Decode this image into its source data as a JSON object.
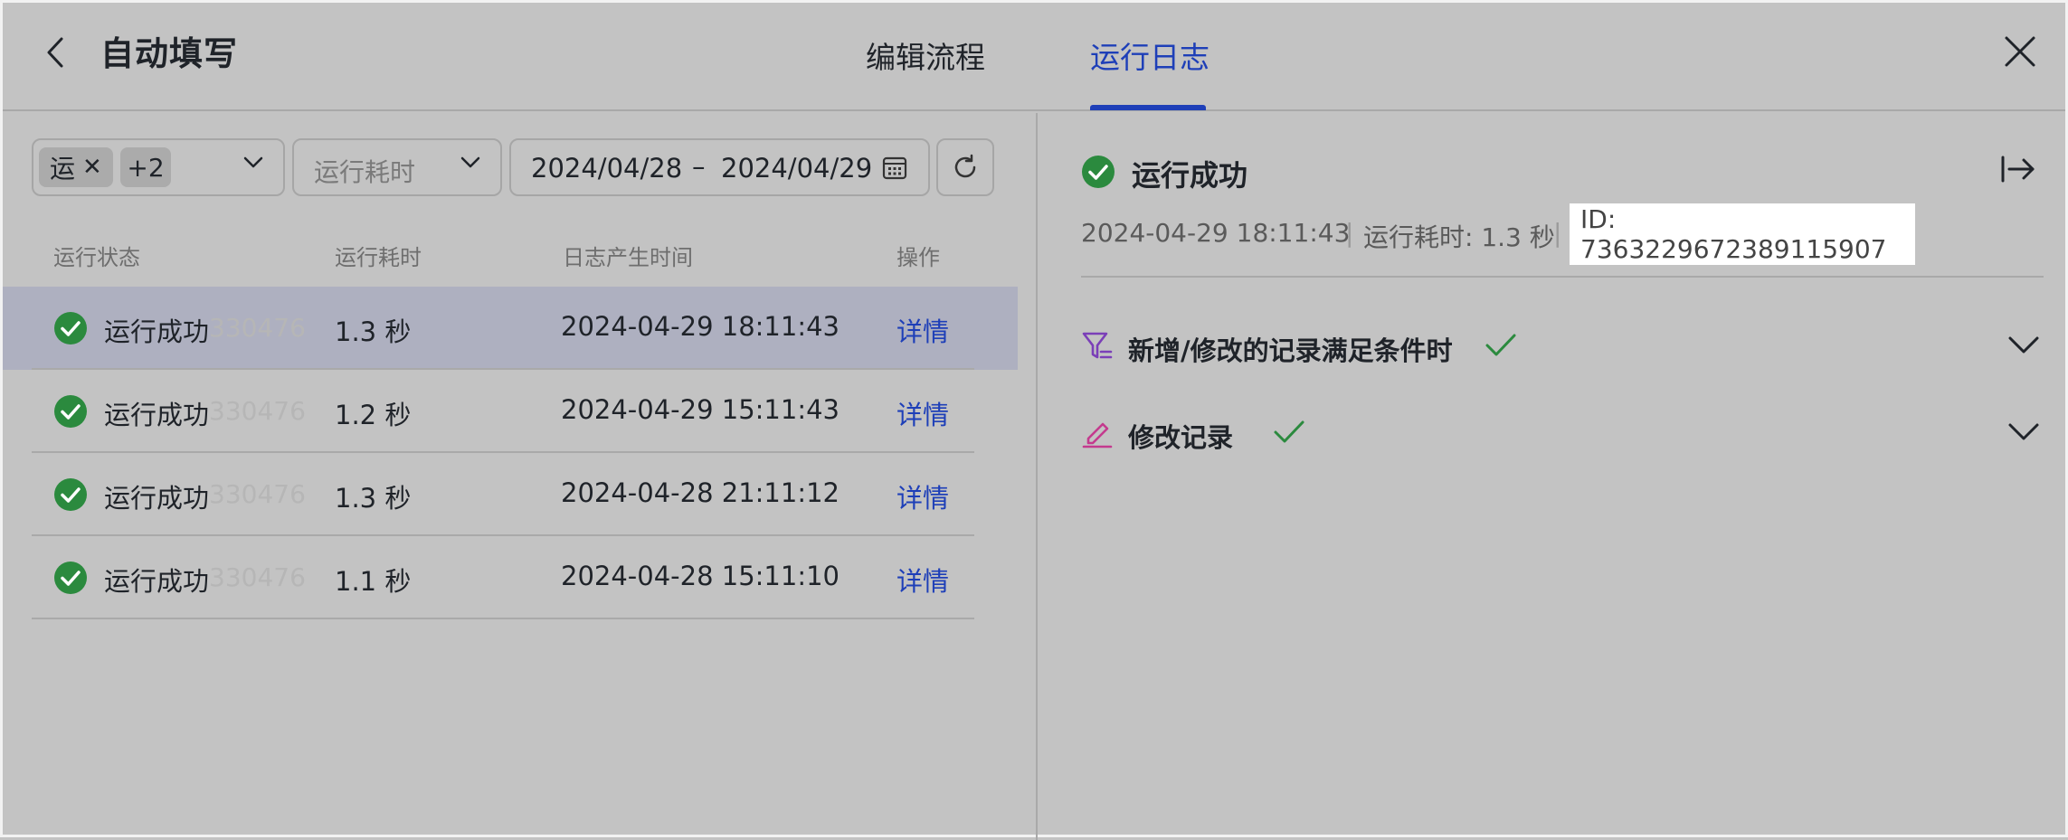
{
  "header": {
    "title": "自动填写",
    "tabs": [
      {
        "label": "编辑流程",
        "active": false
      },
      {
        "label": "运行日志",
        "active": true
      }
    ]
  },
  "colors": {
    "accent": "#1e3fb8",
    "success": "#2b8a3e",
    "filter_icon": "#7b3fb8",
    "edit_icon": "#c43a8e",
    "background": "#c3c3c3"
  },
  "filters": {
    "status_tag": "运",
    "status_more": "+2",
    "duration_placeholder": "运行耗时",
    "date_start": "2024/04/28",
    "date_separator": "–",
    "date_end": "2024/04/29"
  },
  "table": {
    "headers": {
      "status": "运行状态",
      "duration": "运行耗时",
      "time": "日志产生时间",
      "action": "操作"
    },
    "rows": [
      {
        "status": "运行成功",
        "ghost": "330476",
        "duration": "1.3 秒",
        "time": "2024-04-29 18:11:43",
        "action": "详情",
        "selected": true
      },
      {
        "status": "运行成功",
        "ghost": "330476",
        "duration": "1.2 秒",
        "time": "2024-04-29 15:11:43",
        "action": "详情",
        "selected": false
      },
      {
        "status": "运行成功",
        "ghost": "330476",
        "duration": "1.3 秒",
        "time": "2024-04-28 21:11:12",
        "action": "详情",
        "selected": false
      },
      {
        "status": "运行成功",
        "ghost": "330476",
        "duration": "1.1 秒",
        "time": "2024-04-28 15:11:10",
        "action": "详情",
        "selected": false
      }
    ]
  },
  "detail": {
    "status": "运行成功",
    "time": "2024-04-29 18:11:43",
    "separator": "|",
    "duration": "运行耗时: 1.3 秒",
    "id": "ID: 7363229672389115907",
    "steps": [
      {
        "label": "新增/修改的记录满足条件时",
        "icon": "filter-icon",
        "done": true
      },
      {
        "label": "修改记录",
        "icon": "edit-icon",
        "done": true
      }
    ]
  }
}
